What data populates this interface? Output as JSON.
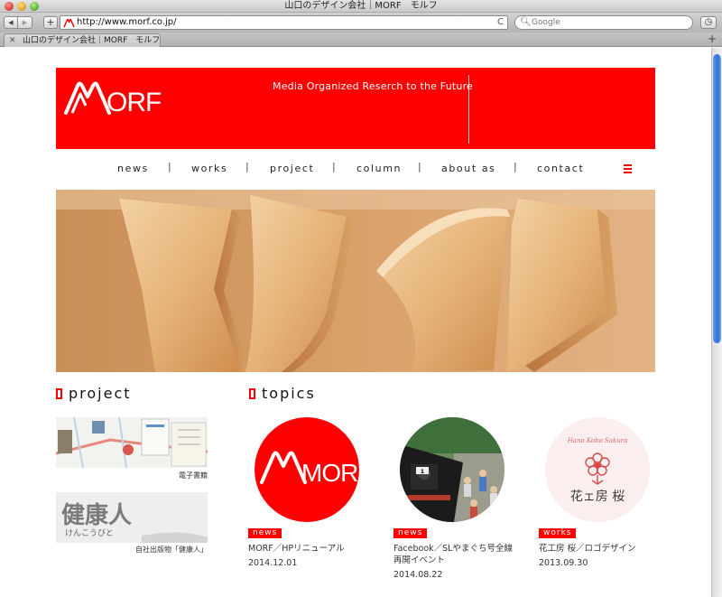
{
  "window": {
    "title": "山口のデザイン会社｜MORF　モルフ"
  },
  "toolbar": {
    "url": "http://www.morf.co.jp/",
    "search_placeholder": "Google",
    "back_icon": "◀",
    "forward_icon": "▶",
    "add_icon": "+",
    "reload_icon": "C",
    "clock_icon": "◷"
  },
  "tab": {
    "label": "山口のデザイン会社｜MORF　モルフ"
  },
  "header": {
    "tagline": "Media Organized Reserch to the Future",
    "logo_text": "MORF",
    "brand_color": "#ff0000"
  },
  "nav": {
    "items": [
      "news",
      "works",
      "project",
      "column",
      "about as",
      "contact"
    ],
    "separator": "|"
  },
  "project": {
    "title": "project",
    "items": [
      {
        "caption": "電子書籍"
      },
      {
        "caption": "自社出版物「健康人」",
        "image_text": "健康人",
        "image_subtext": "けんこうびと"
      }
    ]
  },
  "topics": {
    "title": "topics",
    "items": [
      {
        "badge": "news",
        "title": "MORF／HPリニューアル",
        "date": "2014.12.01",
        "logo_text": "MORF"
      },
      {
        "badge": "news",
        "title": "Facebook／SLやまぐち号全線再開イベント",
        "date": "2014.08.22",
        "train_plate": "1"
      },
      {
        "badge": "works",
        "title": "花工房 桜／ロゴデザイン",
        "date": "2013.09.30",
        "logo_text": "花ェ房 桜",
        "logo_script": "Hana Kobo Sakura"
      }
    ]
  }
}
